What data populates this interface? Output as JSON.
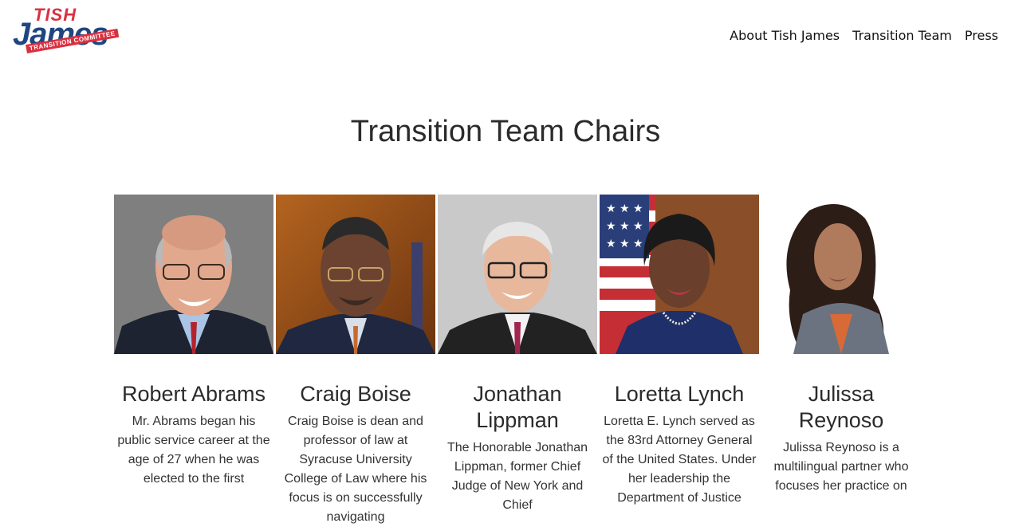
{
  "logo": {
    "line1": "TISH",
    "line2": "James",
    "banner": "TRANSITION COMMITTEE"
  },
  "nav": [
    {
      "label": "About Tish James"
    },
    {
      "label": "Transition Team"
    },
    {
      "label": "Press"
    }
  ],
  "page": {
    "title": "Transition Team Chairs"
  },
  "chairs": [
    {
      "name": "Robert Abrams",
      "bio": "Mr. Abrams began his public service career at the age of 27 when he was elected to the first"
    },
    {
      "name": "Craig Boise",
      "bio": "Craig Boise is dean and professor of law at Syracuse University College of Law where his focus is on successfully navigating"
    },
    {
      "name": "Jonathan Lippman",
      "bio": "The Honorable Jonathan Lippman, former Chief Judge of New York and Chief"
    },
    {
      "name": "Loretta Lynch",
      "bio": "Loretta E. Lynch served as the 83rd Attorney General of the United States. Under her leadership the Department of Justice"
    },
    {
      "name": "Julissa Reynoso",
      "bio": "Julissa Reynoso is a multilingual partner who focuses her practice on"
    }
  ],
  "colors": {
    "brand_red": "#d9303f",
    "brand_blue": "#1f4680"
  }
}
